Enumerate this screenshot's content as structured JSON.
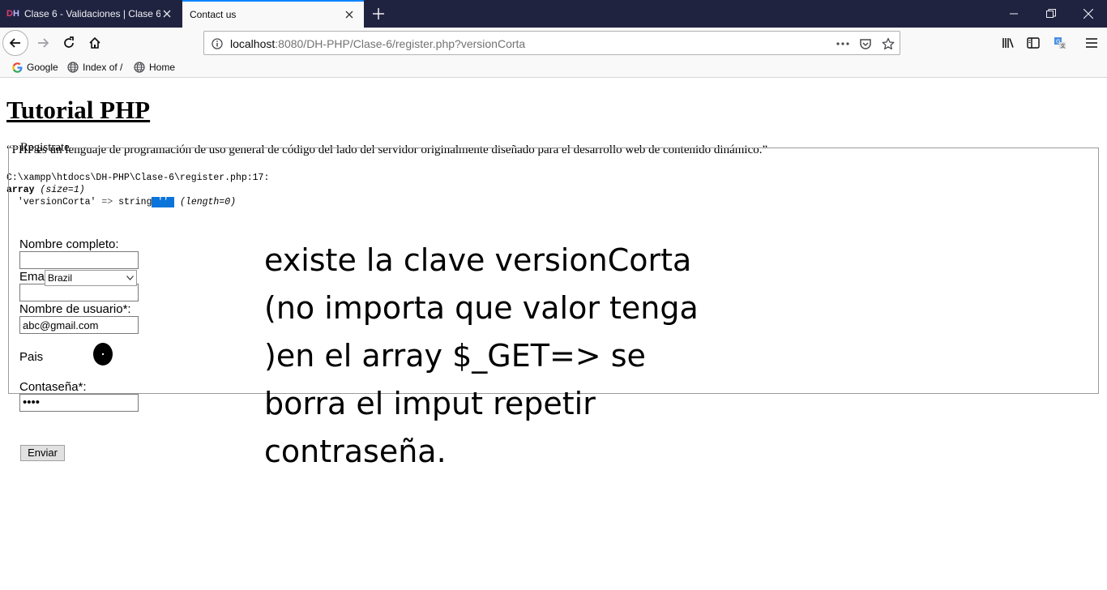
{
  "browser": {
    "tabs": [
      {
        "label": "Clase 6 - Validaciones | Clase 6",
        "favicon": "DH",
        "active": false
      },
      {
        "label": "Contact us",
        "active": true
      }
    ],
    "address": {
      "host": "localhost",
      "path": ":8080/DH-PHP/Clase-6/register.php?versionCorta"
    },
    "bookmarks": [
      {
        "label": "Google",
        "icon": "google-icon"
      },
      {
        "label": "Index of /",
        "icon": "globe-icon"
      },
      {
        "label": "Home",
        "icon": "globe-icon"
      }
    ],
    "accent": "#0a84ff",
    "tabstrip_color": "#202340"
  },
  "page": {
    "title": "Tutorial PHP",
    "quote": "“PHP es un lenguaje de programación de uso general de código del lado del servidor originalmente diseñado para el desarrollo web de contenido dinámico.”",
    "dump": {
      "file": "C:\\xampp\\htdocs\\DH-PHP\\Clase-6\\register.php:17:",
      "array_kw": "array",
      "size": "(size=1)",
      "key": "'versionCorta'",
      "arrow": "=>",
      "type": "string",
      "value": "''",
      "length": "(length=0)"
    },
    "form": {
      "legend": "Registrate",
      "fullname_label": "Nombre completo:",
      "fullname_value": "",
      "email_label": "Email:",
      "email_value": "",
      "username_label": "Nombre de usuario*:",
      "username_value": "abc@gmail.com",
      "country_label": "Pais",
      "country_value": "Brazil",
      "password_label": "Contaseña*:",
      "password_value": "••••",
      "submit_label": "Enviar"
    },
    "annotation": [
      "existe la clave versionCorta",
      "(no importa que valor tenga",
      ")en el array $_GET=> se",
      "borra el imput repetir",
      "contraseña."
    ]
  }
}
